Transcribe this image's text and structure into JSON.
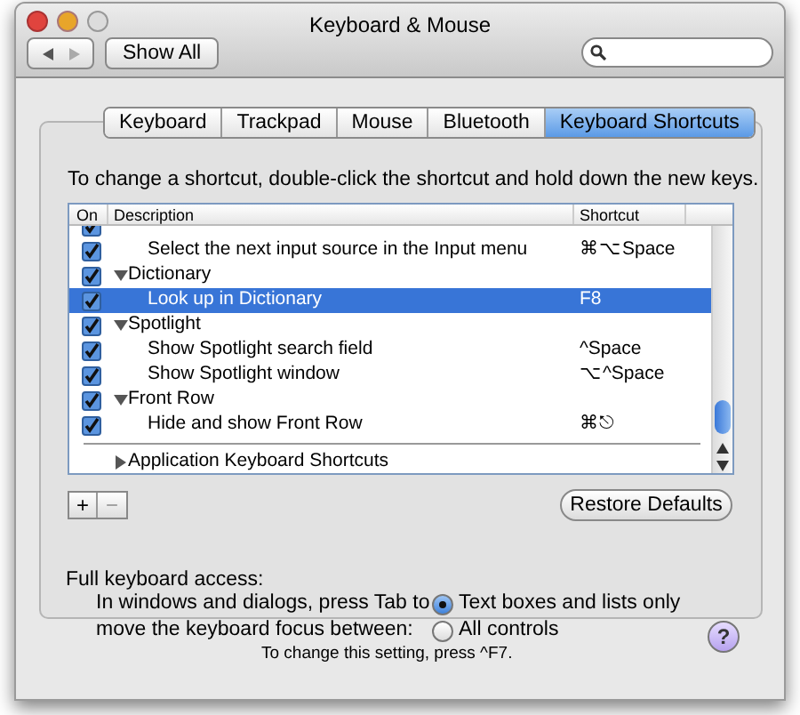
{
  "window": {
    "title": "Keyboard & Mouse"
  },
  "toolbar": {
    "show_all": "Show All"
  },
  "tabs": [
    {
      "label": "Keyboard",
      "selected": false
    },
    {
      "label": "Trackpad",
      "selected": false
    },
    {
      "label": "Mouse",
      "selected": false
    },
    {
      "label": "Bluetooth",
      "selected": false
    },
    {
      "label": "Keyboard Shortcuts",
      "selected": true
    }
  ],
  "instructions": "To change a shortcut, double-click the shortcut and hold down the new keys.",
  "table": {
    "columns": [
      "On",
      "Description",
      "Shortcut"
    ],
    "rows": [
      {
        "kind": "item",
        "on": true,
        "selected": false,
        "clipped": true
      },
      {
        "kind": "item",
        "on": true,
        "selected": false,
        "description": "Select the next input source in the Input menu",
        "shortcut": "⌘⌥Space"
      },
      {
        "kind": "group",
        "on": true,
        "selected": false,
        "expanded": true,
        "description": "Dictionary",
        "children": [
          {
            "kind": "item",
            "on": true,
            "selected": true,
            "description": "Look up in Dictionary",
            "shortcut": "F8"
          }
        ]
      },
      {
        "kind": "group",
        "on": true,
        "selected": false,
        "expanded": true,
        "description": "Spotlight",
        "children": [
          {
            "kind": "item",
            "on": true,
            "selected": false,
            "description": "Show Spotlight search field",
            "shortcut": "^Space"
          },
          {
            "kind": "item",
            "on": true,
            "selected": false,
            "description": "Show Spotlight window",
            "shortcut": "⌥^Space"
          }
        ]
      },
      {
        "kind": "group",
        "on": true,
        "selected": false,
        "expanded": true,
        "description": "Front Row",
        "children": [
          {
            "kind": "item",
            "on": true,
            "selected": false,
            "description": "Hide and show Front Row",
            "shortcut": "⌘⎋"
          }
        ]
      }
    ],
    "footer_group": {
      "description": "Application Keyboard Shortcuts",
      "expanded": false
    }
  },
  "add_button": "+",
  "remove_button": "−",
  "restore_button": "Restore Defaults",
  "keyboard_access": {
    "heading": "Full keyboard access:",
    "description": [
      "In windows and dialogs, press Tab to",
      "move the keyboard focus between:"
    ],
    "options": [
      {
        "label": "Text boxes and lists only",
        "selected": true
      },
      {
        "label": "All controls",
        "selected": false
      }
    ],
    "note": "To change this setting, press ^F7."
  },
  "help_button": "?"
}
